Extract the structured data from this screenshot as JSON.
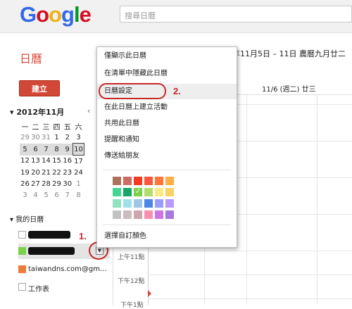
{
  "header": {
    "logo_letters": [
      "G",
      "o",
      "o",
      "g",
      "l",
      "e"
    ],
    "logo_colors": [
      "#3369e8",
      "#d50f25",
      "#eeb211",
      "#3369e8",
      "#009925",
      "#d50f25"
    ],
    "search_placeholder": "搜尋日曆"
  },
  "app_title": "日曆",
  "date_range": "年11月5日 – 11日 農曆九月廿二",
  "create_button": "建立",
  "mini_calendar": {
    "month_label": "2012年11月",
    "prev_icon": "‹",
    "toggle_icon": "▾",
    "weekdays": [
      "一",
      "二",
      "三",
      "四",
      "五",
      "六"
    ],
    "weeks": [
      [
        "29",
        "30",
        "31",
        "1",
        "2",
        "3"
      ],
      [
        "5",
        "6",
        "7",
        "8",
        "9",
        "10"
      ],
      [
        "12",
        "13",
        "14",
        "15",
        "16",
        "17"
      ],
      [
        "19",
        "20",
        "21",
        "22",
        "23",
        "24"
      ],
      [
        "26",
        "27",
        "28",
        "29",
        "30",
        "1"
      ],
      [
        "3",
        "4",
        "5",
        "6",
        "7",
        "8"
      ]
    ]
  },
  "my_calendars": {
    "title": "我的日曆",
    "toggle_icon": "▾",
    "items": [
      {
        "label": "",
        "color": "#ffffff"
      },
      {
        "label": "",
        "color": "#7bd148"
      },
      {
        "label": "taiwandns.com@gm...",
        "color": "#f07c3a"
      },
      {
        "label": "工作表",
        "color": "#ffffff"
      }
    ]
  },
  "annotations": {
    "one": "1.",
    "two": "2."
  },
  "grid": {
    "day_header": "11/6 (週二) 廿三",
    "times": [
      "上午11點",
      "下午12點",
      "下午1點"
    ]
  },
  "menu": {
    "items": [
      "僅顯示此日曆",
      "在清單中隱藏此日曆",
      "日曆設定",
      "在此日曆上建立活動",
      "共用此日曆",
      "提醒和通知",
      "傳送給朋友"
    ],
    "custom_color": "選擇自訂顏色",
    "palette": [
      [
        "#ac725e",
        "#d06b64",
        "#f83a22",
        "#fa573c",
        "#ff7537",
        "#ffad46"
      ],
      [
        "#42d692",
        "#16a765",
        "#7bd148",
        "#b3dc6c",
        "#fbe983",
        "#fad165"
      ],
      [
        "#92e1c0",
        "#9fe1e7",
        "#9fc6e7",
        "#4986e7",
        "#9a9cff",
        "#b99aff"
      ],
      [
        "#c2c2c2",
        "#cabdbf",
        "#cca6ac",
        "#f691b2",
        "#cd74e6",
        "#a47ae2"
      ]
    ],
    "selected_color": "#7bd148",
    "check_icon": "✓"
  }
}
